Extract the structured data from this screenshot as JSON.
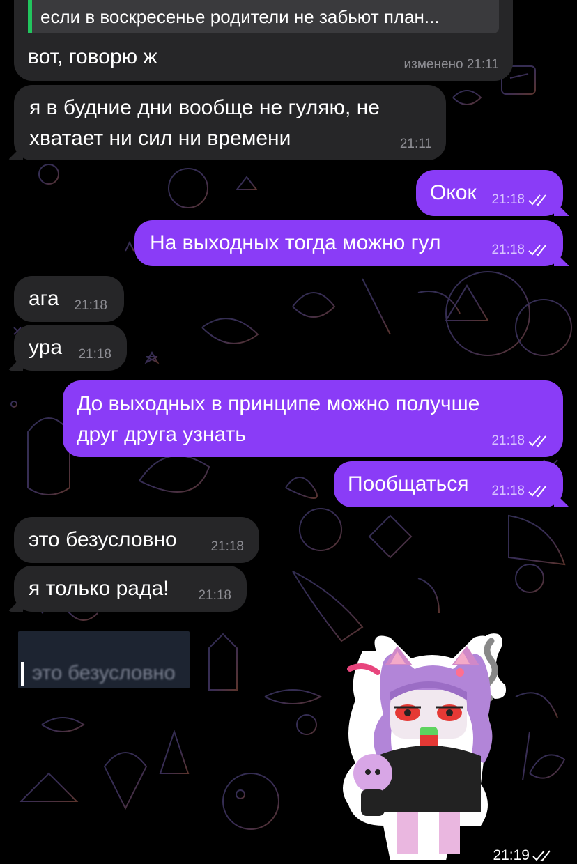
{
  "colors": {
    "background": "#000000",
    "incoming_bubble": "#262628",
    "outgoing_bubble": "#8a3cf7",
    "reply_accent": "#22c55e"
  },
  "icons": [
    "double-check-icon",
    "reply-bar"
  ],
  "messages": [
    {
      "id": "m1",
      "direction": "incoming",
      "text": "вот, говорю ж",
      "time": "изменено 21:11",
      "reply_preview": "если в воскресенье родители не забьют план..."
    },
    {
      "id": "m2",
      "direction": "incoming",
      "text": "я в будние дни вообще не гуляю, не\nхватает ни сил ни времени",
      "time": "21:11"
    },
    {
      "id": "m3",
      "direction": "outgoing",
      "text": "Окок",
      "time": "21:18",
      "read": true
    },
    {
      "id": "m4",
      "direction": "outgoing",
      "text": "На выходных тогда можно гул",
      "time": "21:18",
      "read": true
    },
    {
      "id": "m5",
      "direction": "incoming",
      "text": "ага",
      "time": "21:18"
    },
    {
      "id": "m6",
      "direction": "incoming",
      "text": "ура",
      "time": "21:18"
    },
    {
      "id": "m7",
      "direction": "outgoing",
      "text": "До выходных в принципе можно получше\nдруг друга узнать",
      "time": "21:18",
      "read": true
    },
    {
      "id": "m8",
      "direction": "outgoing",
      "text": "Пообщаться",
      "time": "21:18",
      "read": true
    },
    {
      "id": "m9",
      "direction": "incoming",
      "text": "это безусловно",
      "time": "21:18"
    },
    {
      "id": "m10",
      "direction": "incoming",
      "text": "я только рада!",
      "time": "21:18"
    }
  ],
  "quote_card": {
    "text": "это безусловно"
  },
  "sticker_message": {
    "direction": "outgoing",
    "time": "21:19",
    "read": true,
    "sticker_icon": "anime-cat-girl-sticker"
  }
}
